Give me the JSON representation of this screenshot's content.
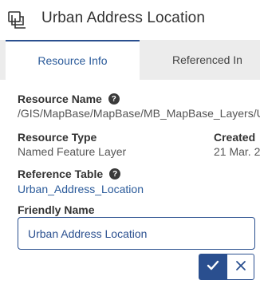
{
  "header": {
    "title": "Urban Address Location",
    "icon": "layer-stack-icon"
  },
  "tabs": [
    {
      "label": "Resource Info",
      "active": true
    },
    {
      "label": "Referenced In",
      "active": false
    }
  ],
  "fields": {
    "resource_name": {
      "label": "Resource Name",
      "value": "/GIS/MapBase/MapBase/MB_MapBase_Layers/U"
    },
    "resource_type": {
      "label": "Resource Type",
      "value": "Named Feature Layer"
    },
    "created": {
      "label": "Created",
      "value": "21 Mar. 2"
    },
    "reference_table": {
      "label": "Reference Table",
      "value": "Urban_Address_Location"
    },
    "friendly_name": {
      "label": "Friendly Name",
      "value": "Urban Address Location"
    }
  },
  "help_glyph": "?",
  "colors": {
    "accent": "#2a4f8f",
    "tab_bar": "#ececec",
    "link": "#2a5a9a"
  }
}
